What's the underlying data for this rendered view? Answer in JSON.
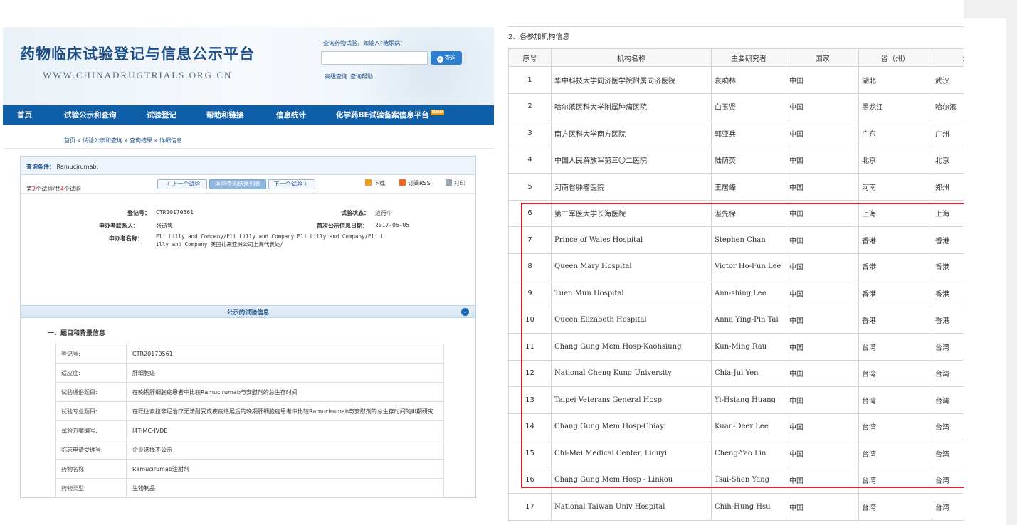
{
  "left": {
    "site_title": "药物临床试验登记与信息公示平台",
    "site_url": "WWW.CHINADRUGTRIALS.ORG.CN",
    "search_hint": "查询药物试验，如输入“糖尿病”",
    "search_button": "查询",
    "search_links": [
      "高级查询",
      "查询帮助"
    ],
    "nav": [
      "首页",
      "试验公示和查询",
      "试验登记",
      "帮助和链接",
      "信息统计",
      "化学药BE试验备案信息平台"
    ],
    "nav_badge": "NEW",
    "breadcrumb": "首页 » 试验公示和查询 » 查询结果 » 详细信息",
    "query_label": "查询条件：",
    "query_value": "Ramucirumab;",
    "trial_count_prefix": "第",
    "trial_index": "2",
    "trial_count_mid": "个试验/共",
    "trial_total": "4",
    "trial_count_suffix": "个试验",
    "prev_button": "〈 上一个试验",
    "back_button": "返回查询结果列表",
    "next_button": "下一个试验 〉",
    "download": "下载",
    "rss": "订阅RSS",
    "print": "打印",
    "reg_no_label": "登记号：",
    "reg_no": "CTR20170561",
    "status_label": "试验状态：",
    "status": "进行中",
    "contact_label": "申办者联系人：",
    "contact": "张诗隽",
    "first_date_label": "首次公示信息日期：",
    "first_date": "2017-06-05",
    "sponsor_label": "申办者名称：",
    "sponsor_line1": "Eli Lilly and Company/Eli Lilly and Company  Eli Lilly and Company/Eli L",
    "sponsor_line2": "illy and Company  美国礼来亚洲公司上海代表处/",
    "public_title": "公示的试验信息",
    "section_title": "一、题目和背景信息",
    "rows": [
      {
        "k": "登记号:",
        "v": "CTR20170561"
      },
      {
        "k": "适应症:",
        "v": "肝细胞癌"
      },
      {
        "k": "试验通俗题目:",
        "v": "在晚期肝细胞癌患者中比较Ramucirumab与安慰剂的总生存时间"
      },
      {
        "k": "试验专业题目:",
        "v": "在既往索拉非尼治疗无法耐受或疾病进展后的晚期肝细胞癌患者中比较Ramucirumab与安慰剂的总生存时间的III期研究"
      },
      {
        "k": "试验方案编号:",
        "v": "I4T-MC-JVDE"
      },
      {
        "k": "临床申请受理号:",
        "v": "企业选择不公示"
      },
      {
        "k": "药物名称:",
        "v": "Ramucirumab注射剂"
      },
      {
        "k": "药物类型:",
        "v": "生物制品"
      }
    ]
  },
  "right": {
    "title": "2、各参加机构信息",
    "headers": [
      "序号",
      "机构名称",
      "主要研究者",
      "国家",
      "省（州）",
      "城市"
    ],
    "rows": [
      [
        "1",
        "华中科技大学同济医学院附属同济医院",
        "袁响林",
        "中国",
        "湖北",
        "武汉"
      ],
      [
        "2",
        "哈尔滨医科大学附属肿瘤医院",
        "白玉贤",
        "中国",
        "黑龙江",
        "哈尔滨"
      ],
      [
        "3",
        "南方医科大学南方医院",
        "郭亚兵",
        "中国",
        "广东",
        "广州"
      ],
      [
        "4",
        "中国人民解放军第三〇二医院",
        "陆荫英",
        "中国",
        "北京",
        "北京"
      ],
      [
        "5",
        "河南省肿瘤医院",
        "王居峰",
        "中国",
        "河南",
        "郑州"
      ],
      [
        "6",
        "第二军医大学长海医院",
        "湛先保",
        "中国",
        "上海",
        "上海"
      ],
      [
        "7",
        "Prince of Wales Hospital",
        "Stephen Chan",
        "中国",
        "香港",
        "香港"
      ],
      [
        "8",
        "Queen Mary Hospital",
        "Victor Ho-Fun Lee",
        "中国",
        "香港",
        "香港"
      ],
      [
        "9",
        "Tuen Mun Hospital",
        "Ann-shing Lee",
        "中国",
        "香港",
        "香港"
      ],
      [
        "10",
        "Queen Elizabeth Hospital",
        "Anna Ying-Pin Tai",
        "中国",
        "香港",
        "香港"
      ],
      [
        "11",
        "Chang Gung Mem Hosp-Kaohsiung",
        "Kun-Ming Rau",
        "中国",
        "台湾",
        "台湾"
      ],
      [
        "12",
        "National Cheng Kung University",
        "Chia-Jui Yen",
        "中国",
        "台湾",
        "台湾"
      ],
      [
        "13",
        "Taipei Veterans General Hosp",
        "Yi-Hsiang Huang",
        "中国",
        "台湾",
        "台湾"
      ],
      [
        "14",
        "Chang Gung Mem Hosp-Chiayi",
        "Kuan-Deer Lee",
        "中国",
        "台湾",
        "台湾"
      ],
      [
        "15",
        "Chi-Mei Medical Center, Liouyi",
        "Cheng-Yao Lin",
        "中国",
        "台湾",
        "台湾"
      ],
      [
        "16",
        "Chang Gung Mem Hosp - Linkou",
        "Tsai-Shen Yang",
        "中国",
        "台湾",
        "台湾"
      ],
      [
        "17",
        "National Taiwan Univ Hospital",
        "Chih-Hung Hsu",
        "中国",
        "台湾",
        "台湾"
      ]
    ]
  },
  "colors": {
    "nav_bg": "#0f5ea8",
    "brand": "#1d4f86",
    "highlight": "#d6212a",
    "count_red": "#d21010"
  }
}
